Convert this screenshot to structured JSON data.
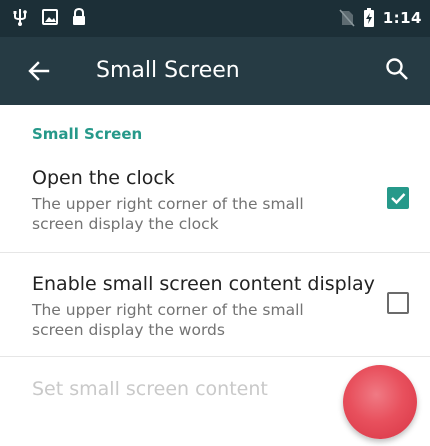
{
  "status_bar": {
    "time": "1:14",
    "icons": [
      "usb-icon",
      "image-icon",
      "lock-icon",
      "no-sim-icon",
      "battery-charging-icon"
    ]
  },
  "app_bar": {
    "title": "Small Screen",
    "back_icon": "arrow-left-icon",
    "search_icon": "search-icon"
  },
  "section": {
    "header": "Small Screen"
  },
  "preferences": [
    {
      "title": "Open the clock",
      "summary": "The upper right corner of the small screen display the clock",
      "checked": true
    },
    {
      "title": "Enable small screen content display",
      "summary": "The upper right corner of the small screen display the words",
      "checked": false
    }
  ],
  "disabled_item": {
    "title": "Set small screen content"
  },
  "colors": {
    "status_bar": "#1c2f37",
    "app_bar": "#263b44",
    "accent": "#26998a",
    "fab": "#e8505d"
  }
}
